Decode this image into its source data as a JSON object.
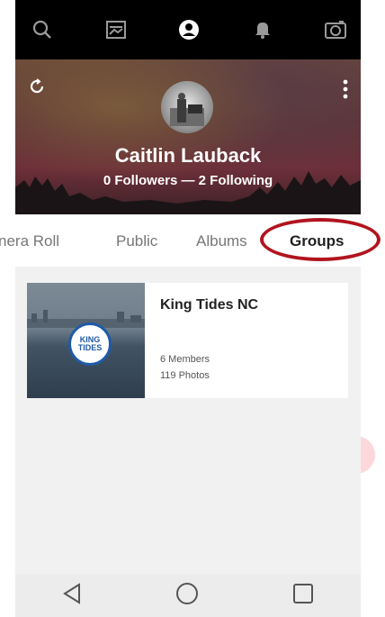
{
  "toolbar": {
    "icons": [
      "search-icon",
      "feed-icon",
      "profile-icon",
      "bell-icon",
      "camera-icon"
    ]
  },
  "profile": {
    "name": "Caitlin Lauback",
    "followers_line": "0 Followers — 2 Following"
  },
  "tabs": [
    {
      "label": "nera Roll"
    },
    {
      "label": "Public"
    },
    {
      "label": "Albums"
    },
    {
      "label": "Groups",
      "active": true
    }
  ],
  "groups": [
    {
      "title": "King Tides NC",
      "badge_text": "KING TIDES",
      "members": "6 Members",
      "photos": "119 Photos"
    }
  ],
  "colors": {
    "highlight_ring": "#b2141e",
    "highlight_fill": "#fcd8dc"
  },
  "system_nav": [
    "back-icon",
    "home-icon",
    "recents-icon"
  ]
}
